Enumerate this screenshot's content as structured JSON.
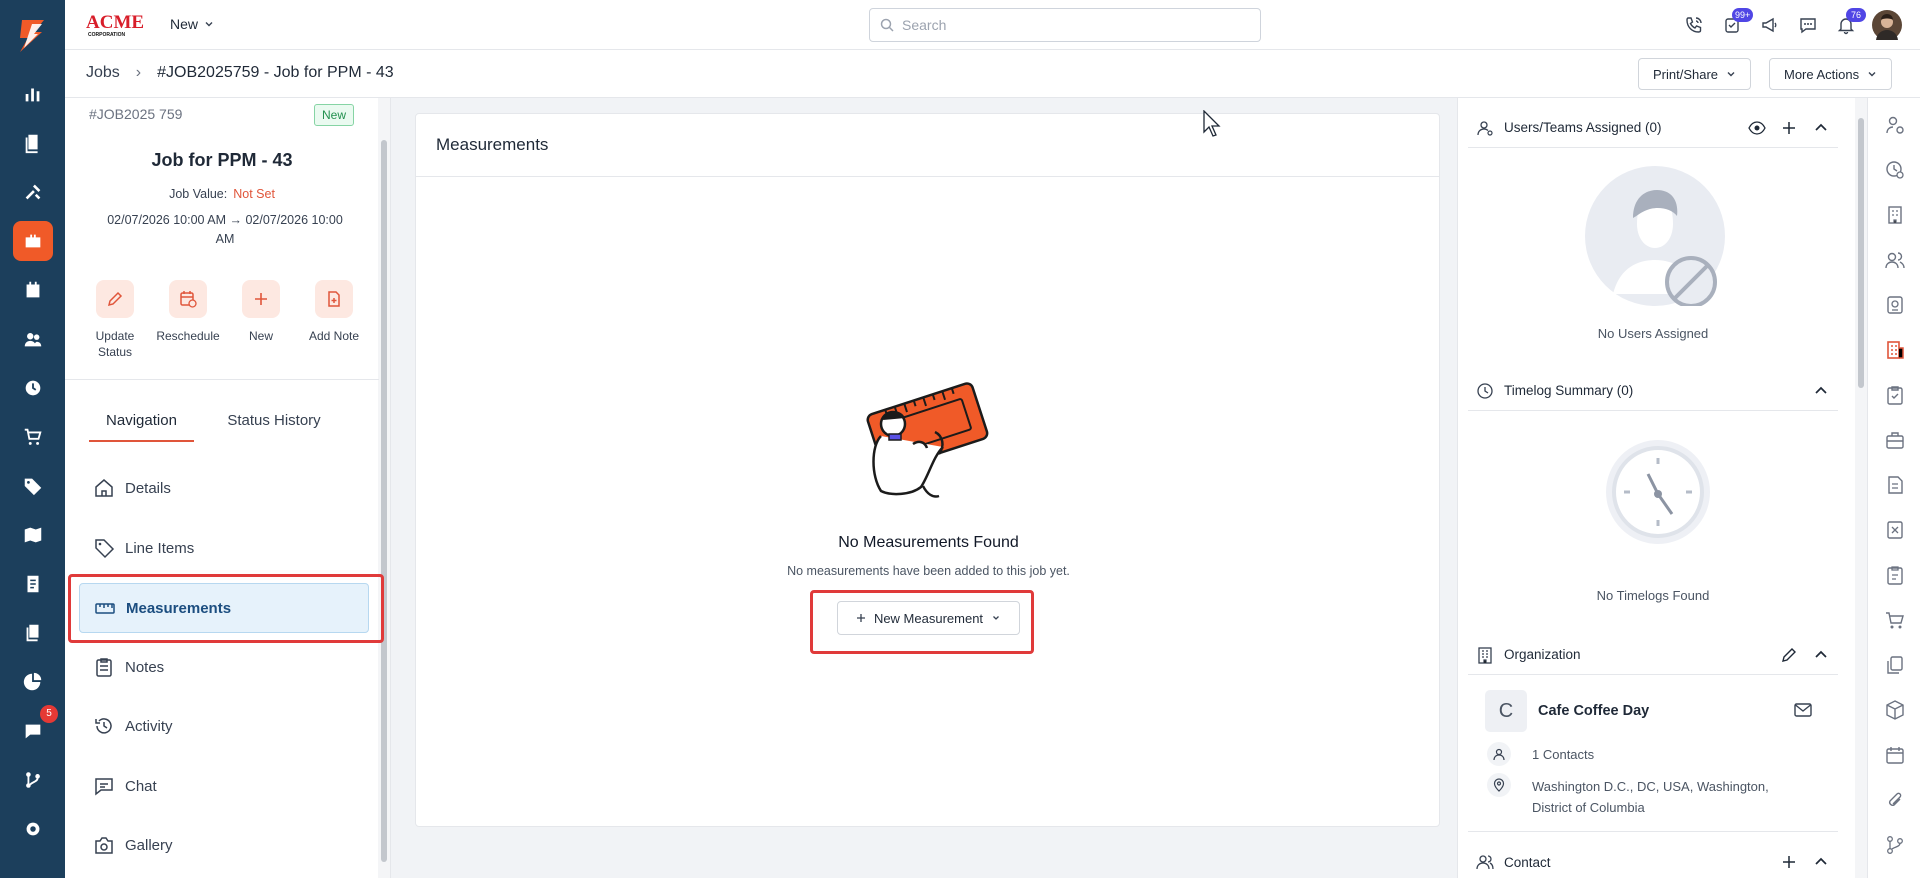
{
  "topbar": {
    "brand": "ACME CORPORATION",
    "new_label": "New",
    "search_placeholder": "Search",
    "tasks_badge": "99+",
    "notif_badge": "76"
  },
  "rail": {
    "chat_badge": "5"
  },
  "breadcrumb": {
    "root": "Jobs",
    "sep": "›",
    "current": "#JOB2025759 - Job for PPM - 43"
  },
  "actions": {
    "print_share": "Print/Share",
    "more_actions": "More Actions"
  },
  "job": {
    "id": "#JOB2025 759",
    "status": "New",
    "title": "Job for PPM - 43",
    "value_label": "Job Value:",
    "value": "Not Set",
    "dates_line1": "02/07/2026 10:00 AM → 02/07/2026 10:00",
    "dates_line2": "AM"
  },
  "quick_actions": {
    "update_status_1": "Update",
    "update_status_2": "Status",
    "reschedule": "Reschedule",
    "new": "New",
    "add_note": "Add Note"
  },
  "tabs": {
    "navigation": "Navigation",
    "status_history": "Status History"
  },
  "nav": {
    "details": "Details",
    "line_items": "Line Items",
    "measurements": "Measurements",
    "notes": "Notes",
    "activity": "Activity",
    "chat": "Chat",
    "gallery": "Gallery"
  },
  "measurements": {
    "header": "Measurements",
    "empty_title": "No Measurements Found",
    "empty_sub": "No measurements have been added to this job yet.",
    "new_button": "New Measurement"
  },
  "right": {
    "users_title": "Users/Teams Assigned (0)",
    "no_users": "No Users Assigned",
    "timelog_title": "Timelog Summary (0)",
    "no_timelogs": "No Timelogs Found",
    "org_title": "Organization",
    "org_initial": "C",
    "org_name": "Cafe Coffee Day",
    "contacts": "1 Contacts",
    "address_1": "Washington D.C., DC, USA, Washington,",
    "address_2": "District of Columbia",
    "contact_title": "Contact"
  },
  "colors": {
    "accent": "#f05a28",
    "rail": "#1c3f5c",
    "highlight": "#e03a3a",
    "active_nav": "#e6f2fb"
  }
}
